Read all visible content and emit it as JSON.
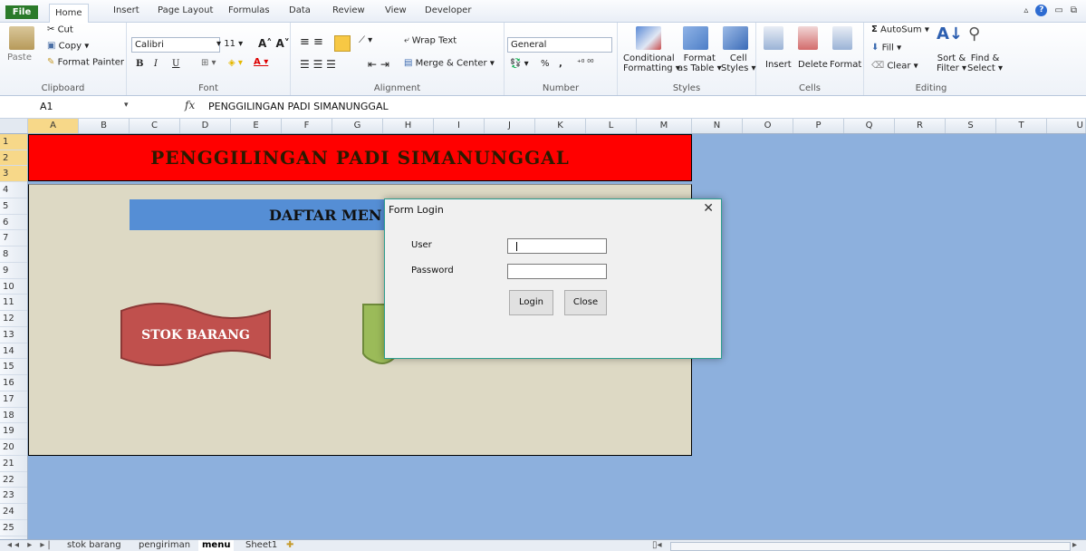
{
  "ribbon_tabs": [
    "File",
    "Home",
    "Insert",
    "Page Layout",
    "Formulas",
    "Data",
    "Review",
    "View",
    "Developer"
  ],
  "clipboard": {
    "paste": "Paste",
    "cut": "Cut",
    "copy": "Copy",
    "format_painter": "Format Painter",
    "label": "Clipboard"
  },
  "font": {
    "name": "Calibri",
    "size": "11",
    "bold": "B",
    "italic": "I",
    "underline": "U",
    "label": "Font"
  },
  "alignment": {
    "wrap_text": "Wrap Text",
    "merge_center": "Merge & Center",
    "label": "Alignment"
  },
  "number": {
    "format": "General",
    "percent": "%",
    "comma": ",",
    "label": "Number"
  },
  "styles": {
    "conditional": "Conditional",
    "conditional2": "Formatting",
    "format_as": "Format",
    "format_as2": "as Table",
    "cell_styles": "Cell",
    "cell_styles2": "Styles",
    "label": "Styles"
  },
  "cells": {
    "insert": "Insert",
    "delete": "Delete",
    "format": "Format",
    "label": "Cells"
  },
  "editing": {
    "autosum": "AutoSum",
    "fill": "Fill",
    "clear": "Clear",
    "sort": "Sort &",
    "sort2": "Filter",
    "find": "Find &",
    "find2": "Select",
    "label": "Editing"
  },
  "formula_bar": {
    "name_box": "A1",
    "fx": "fx",
    "value": "PENGGILINGAN PADI SIMANUNGGAL"
  },
  "columns": [
    "A",
    "B",
    "C",
    "D",
    "E",
    "F",
    "G",
    "H",
    "I",
    "J",
    "K",
    "L",
    "M",
    "N",
    "O",
    "P",
    "Q",
    "R",
    "S",
    "T",
    "U"
  ],
  "rows": [
    "1",
    "2",
    "3",
    "4",
    "5",
    "6",
    "7",
    "8",
    "9",
    "10",
    "11",
    "12",
    "13",
    "14",
    "15",
    "16",
    "17",
    "18",
    "19",
    "20",
    "21",
    "22",
    "23",
    "24",
    "25"
  ],
  "sheet": {
    "title": "PENGGILINGAN PADI SIMANUNGGAL",
    "menu_heading": "DAFTAR MEN",
    "banner_stok": "STOK BARANG"
  },
  "dialog": {
    "title": "Form Login",
    "close_glyph": "✕",
    "user_label": "User",
    "password_label": "Password",
    "login_button": "Login",
    "close_button": "Close"
  },
  "sheet_tabs": [
    "stok barang",
    "pengiriman",
    "menu",
    "Sheet1"
  ],
  "active_sheet": "menu",
  "colors": {
    "title_band": "#ff0000",
    "menu_area": "#ddd9c4",
    "sheet_bg": "#8db0dd",
    "heading_band": "#558ed5",
    "banner_red": "#c0504d",
    "banner_green": "#9bbb59"
  }
}
